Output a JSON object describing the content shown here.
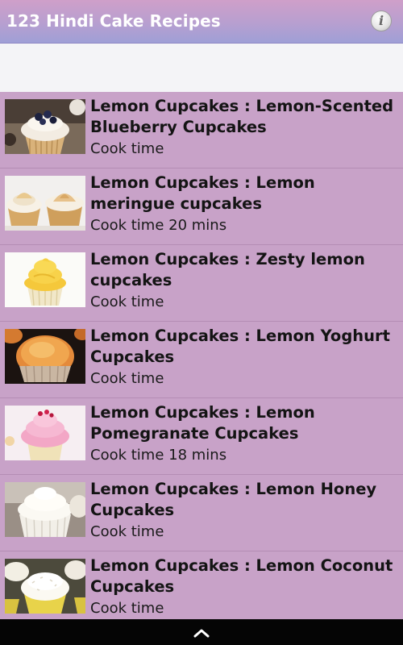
{
  "app_bar": {
    "title": "123 Hindi Cake Recipes",
    "info_icon": "info-icon",
    "accent": "#b79fd0"
  },
  "list_background": "#c8a2c8",
  "recipes": [
    {
      "title": "Lemon Cupcakes : Lemon-Scented Blueberry Cupcakes",
      "subtitle": "Cook time",
      "thumb": "blueberry-cupcake"
    },
    {
      "title": "Lemon Cupcakes : Lemon meringue cupcakes",
      "subtitle": "Cook time 20 mins",
      "thumb": "meringue-cupcake"
    },
    {
      "title": "Lemon Cupcakes : Zesty lemon cupcakes",
      "subtitle": "Cook time",
      "thumb": "yellow-frosted-cupcake"
    },
    {
      "title": "Lemon Cupcakes : Lemon Yoghurt Cupcakes",
      "subtitle": "Cook time",
      "thumb": "plain-muffin"
    },
    {
      "title": "Lemon Cupcakes : Lemon Pomegranate Cupcakes",
      "subtitle": "Cook time 18 mins",
      "thumb": "pink-frosted-cupcake"
    },
    {
      "title": "Lemon Cupcakes :  Lemon Honey Cupcakes",
      "subtitle": "Cook time",
      "thumb": "white-frosted-cupcake"
    },
    {
      "title": "Lemon Cupcakes : Lemon Coconut Cupcakes",
      "subtitle": "Cook time",
      "thumb": "coconut-cupcake"
    }
  ],
  "nav_bar": {
    "icon": "chevron-up-icon"
  }
}
